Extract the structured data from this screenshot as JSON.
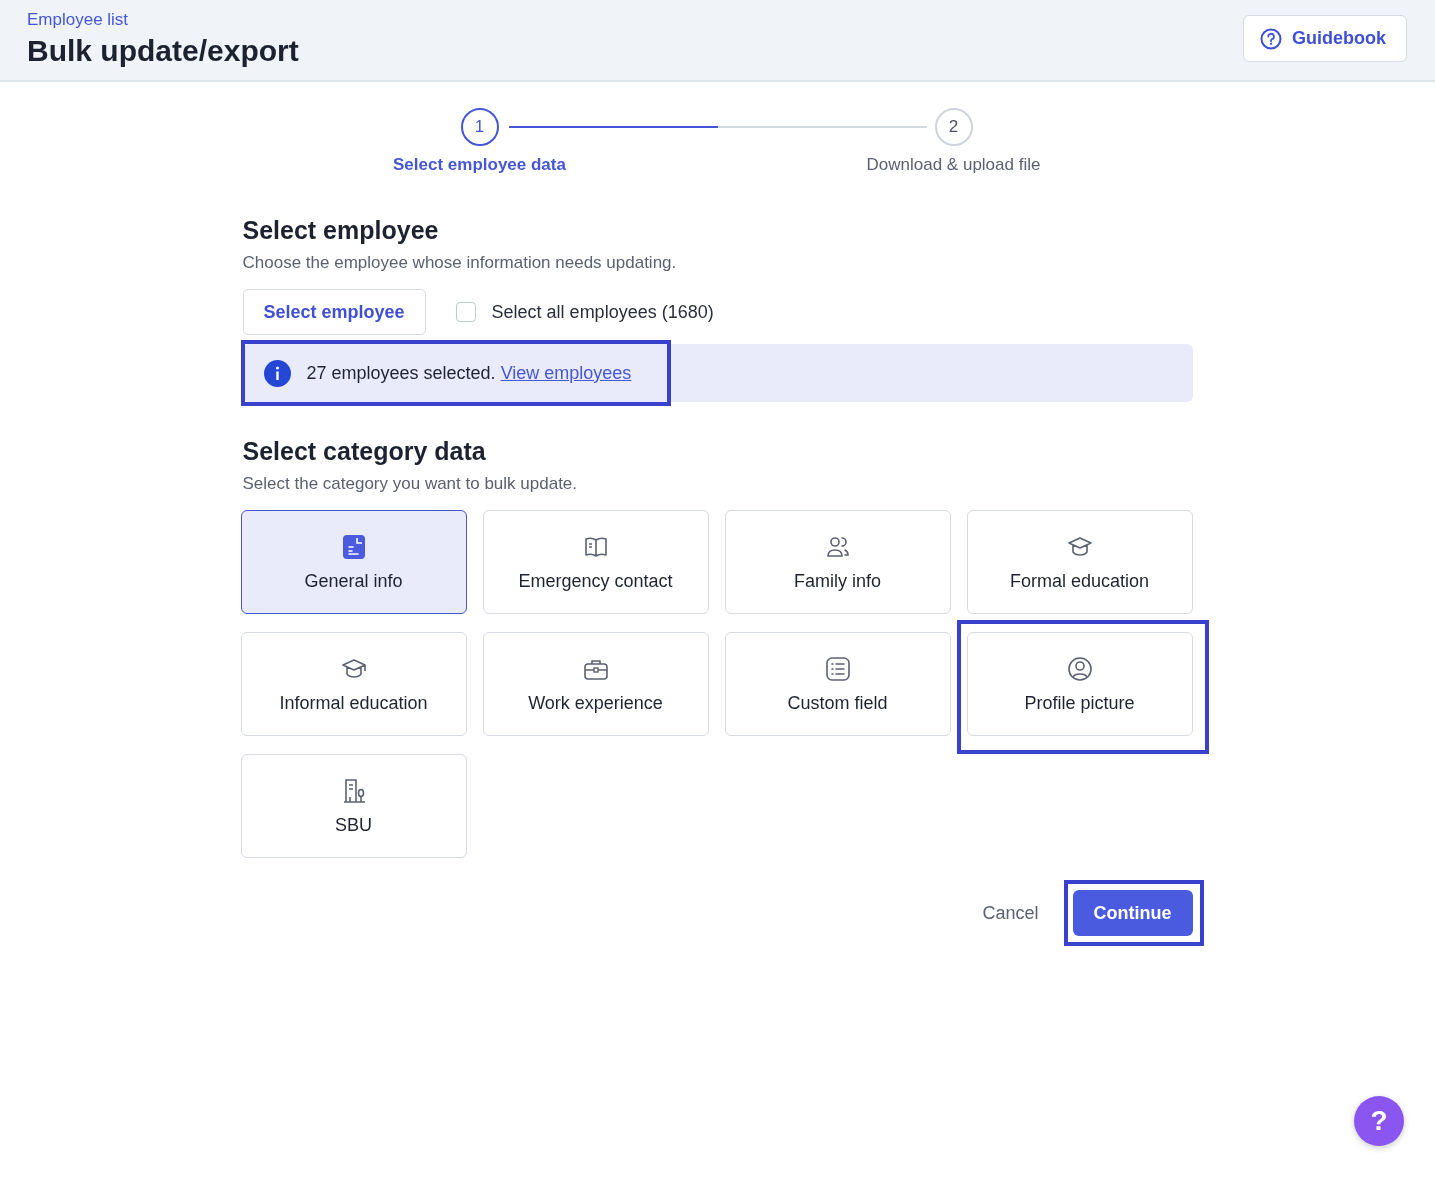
{
  "header": {
    "breadcrumb": "Employee list",
    "title": "Bulk update/export",
    "guidebook_button": "Guidebook"
  },
  "steps": [
    {
      "number": "1",
      "label": "Select employee data",
      "selected": true
    },
    {
      "number": "2",
      "label": "Download & upload file",
      "selected": false
    }
  ],
  "step_progress": {
    "level": 0.5
  },
  "employee_section": {
    "heading": "Select employee",
    "description": "Choose the employee whose information needs updating.",
    "select_button": "Select employee",
    "select_all": {
      "label": "Select all employees (1680)",
      "checked": false
    },
    "info": {
      "text": "27 employees selected.",
      "link": "View employees",
      "highlighted": true
    }
  },
  "category_section": {
    "heading": "Select category data",
    "description": "Select the category you want to bulk update.",
    "categories": [
      {
        "label": "General info",
        "selected": true,
        "highlighted": false
      },
      {
        "label": "Emergency contact",
        "selected": false,
        "highlighted": false
      },
      {
        "label": "Family info",
        "selected": false,
        "highlighted": false
      },
      {
        "label": "Formal education",
        "selected": false,
        "highlighted": false
      },
      {
        "label": "Informal education",
        "selected": false,
        "highlighted": false
      },
      {
        "label": "Work experience",
        "selected": false,
        "highlighted": false
      },
      {
        "label": "Custom field",
        "selected": false,
        "highlighted": false
      },
      {
        "label": "Profile picture",
        "selected": false,
        "highlighted": true
      },
      {
        "label": "SBU",
        "selected": false,
        "highlighted": false
      }
    ]
  },
  "actions": {
    "cancel": "Cancel",
    "continue": {
      "label": "Continue",
      "highlighted": true
    }
  },
  "help_button": "?"
}
